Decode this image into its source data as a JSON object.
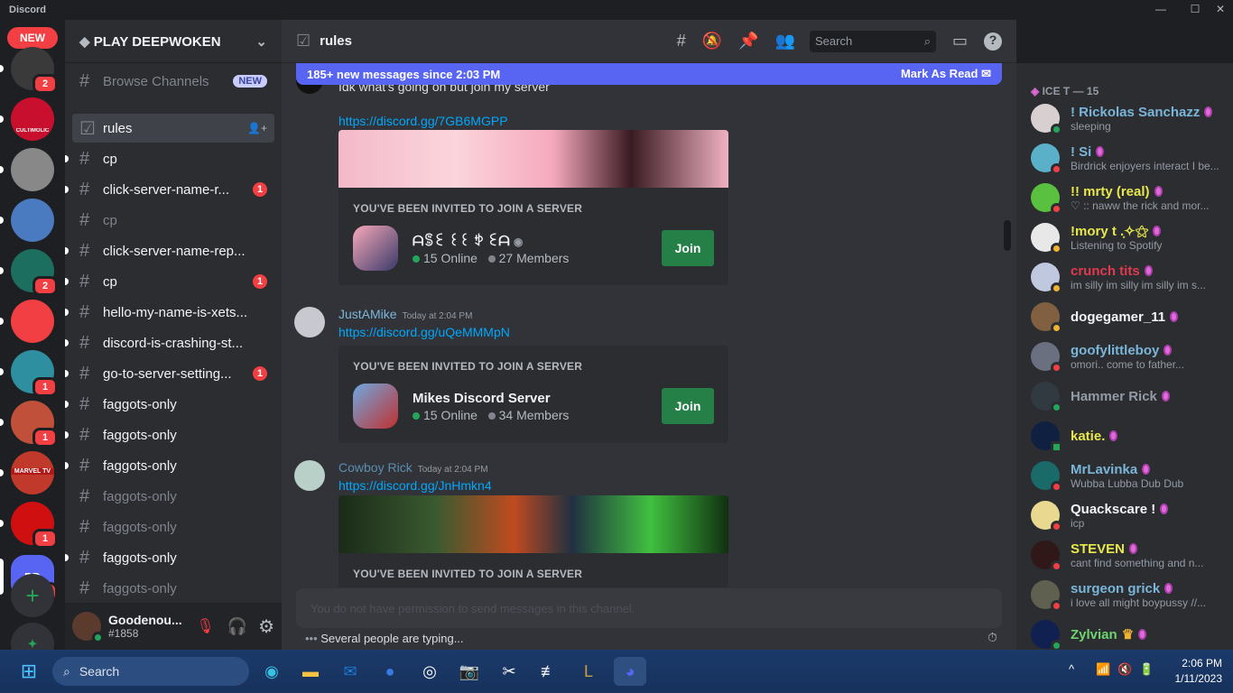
{
  "window": {
    "title": "Discord",
    "controls": [
      "minimize",
      "maximize",
      "close"
    ]
  },
  "rail": {
    "new_badge": "NEW",
    "servers": [
      {
        "name": "server-1",
        "badge": "2",
        "color": "#3a3a3a"
      },
      {
        "name": "Cultimolic",
        "badge": "",
        "color": "#c8102e"
      },
      {
        "name": "F1",
        "badge": "",
        "color": "#888888"
      },
      {
        "name": "server-4",
        "badge": "",
        "color": "#4a7ac0"
      },
      {
        "name": "server-5",
        "badge": "2",
        "color": "#1c6e5e"
      },
      {
        "name": "folder",
        "badge": "",
        "color": "#f23f43"
      },
      {
        "name": "server-7",
        "badge": "1",
        "color": "#2e8fa0"
      },
      {
        "name": "M",
        "badge": "1",
        "color": "#c0503a"
      },
      {
        "name": "Marvel TV",
        "badge": "",
        "color": "#c0392b"
      },
      {
        "name": "server-10",
        "badge": "1",
        "color": "#d01010"
      },
      {
        "name": "PD",
        "badge": "10",
        "color": "#5865f2",
        "label": "PD"
      }
    ]
  },
  "guild": {
    "name": "PLAY DEEPWOKEN",
    "browse": "Browse Channels",
    "browse_badge": "NEW",
    "channels": [
      {
        "name": "rules",
        "state": "selected",
        "badge": ""
      },
      {
        "name": "cp",
        "state": "unread",
        "badge": ""
      },
      {
        "name": "click-server-name-r...",
        "state": "unread",
        "badge": "1"
      },
      {
        "name": "cp",
        "state": "muted",
        "badge": ""
      },
      {
        "name": "click-server-name-rep...",
        "state": "unread",
        "badge": ""
      },
      {
        "name": "cp",
        "state": "unread",
        "badge": "1"
      },
      {
        "name": "hello-my-name-is-xets...",
        "state": "unread",
        "badge": ""
      },
      {
        "name": "discord-is-crashing-st...",
        "state": "unread",
        "badge": ""
      },
      {
        "name": "go-to-server-setting...",
        "state": "unread",
        "badge": "1"
      },
      {
        "name": "faggots-only",
        "state": "unread",
        "badge": ""
      },
      {
        "name": "faggots-only",
        "state": "unread",
        "badge": ""
      },
      {
        "name": "faggots-only",
        "state": "unread",
        "badge": ""
      },
      {
        "name": "faggots-only",
        "state": "muted",
        "badge": ""
      },
      {
        "name": "faggots-only",
        "state": "muted",
        "badge": ""
      },
      {
        "name": "faggots-only",
        "state": "unread",
        "badge": ""
      },
      {
        "name": "faggots-only",
        "state": "muted",
        "badge": ""
      }
    ]
  },
  "user": {
    "name": "Goodenou...",
    "tag": "#1858"
  },
  "chat": {
    "channel": "rules",
    "search_placeholder": "Search",
    "new_messages": "185+ new messages since 2:03 PM",
    "mark_read": "Mark As Read",
    "invite_label": "YOU'VE BEEN INVITED TO JOIN A SERVER",
    "join": "Join",
    "messages": [
      {
        "text": "Idk what's going on but join my server",
        "link": "https://discord.gg/7GB6MGPP",
        "server": "ᗩꌚꏂ ꒰꒰ ꉣ ꏂᗩ",
        "online": "15 Online",
        "members": "27 Members"
      },
      {
        "author": "JustAMike",
        "time": "Today at 2:04 PM",
        "link": "https://discord.gg/uQeMMMpN",
        "server": "Mikes Discord Server",
        "online": "15 Online",
        "members": "34 Members"
      },
      {
        "author": "Cowboy Rick",
        "time": "Today at 2:04 PM",
        "link": "https://discord.gg/JnHmkn4"
      }
    ],
    "input_placeholder": "You do not have permission to send messages in this channel.",
    "typing": "Several people are typing..."
  },
  "members": {
    "group": "ICE T — 15",
    "list": [
      {
        "name": "! Rickolas Sanchazz",
        "status": "sleeping",
        "color": "#7ab6d9",
        "presence": "online"
      },
      {
        "name": "! Si",
        "status": "Birdrick enjoyers interact I be...",
        "color": "#7ab6d9",
        "presence": "dnd"
      },
      {
        "name": "!! mrty (real)",
        "status": "♡ :: naww the rick and mor...",
        "color": "#e8e84a",
        "presence": "dnd"
      },
      {
        "name": "!mory t .͙✧⚝",
        "status": "Listening to Spotify",
        "color": "#e8e84a",
        "presence": "idle"
      },
      {
        "name": "crunch tits",
        "status": "im silly im silly im silly im s...",
        "color": "#e03a4e",
        "presence": "idle"
      },
      {
        "name": "dogegamer_11",
        "status": "",
        "color": "#f2f3f5",
        "presence": "idle"
      },
      {
        "name": "goofylittleboy",
        "status": "omori.. come to father...",
        "color": "#7ab6d9",
        "presence": "dnd"
      },
      {
        "name": "Hammer Rick",
        "status": "",
        "color": "#949ba4",
        "presence": "online"
      },
      {
        "name": "katie.",
        "status": "",
        "color": "#e8e84a",
        "presence": "mobile"
      },
      {
        "name": "MrLavinka",
        "status": "Wubba Lubba Dub Dub",
        "color": "#7ab6d9",
        "presence": "dnd"
      },
      {
        "name": "Quackscare !",
        "status": "icp",
        "color": "#f2f3f5",
        "presence": "dnd"
      },
      {
        "name": "STEVEN",
        "status": "cant find something and n...",
        "color": "#e8e84a",
        "presence": "dnd"
      },
      {
        "name": "surgeon grick",
        "status": "i love all might boypussy //...",
        "color": "#7ab6d9",
        "presence": "dnd"
      },
      {
        "name": "Zylvian",
        "status": "",
        "color": "#6fd46f",
        "presence": "online"
      }
    ]
  },
  "taskbar": {
    "search": "Search",
    "time": "2:06 PM",
    "date": "1/11/2023"
  },
  "colors": {
    "accent": "#5865f2",
    "online": "#23a55a",
    "dnd": "#f23f43",
    "idle": "#f0b232",
    "join": "#248046",
    "link": "#00a8fc"
  }
}
